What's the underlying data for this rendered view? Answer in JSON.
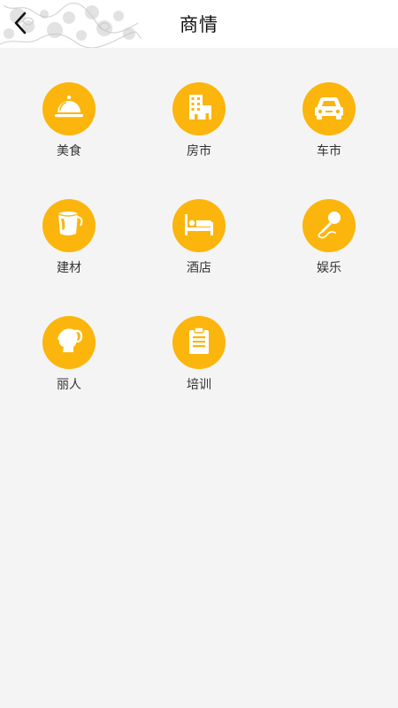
{
  "header": {
    "title": "商情",
    "back_icon": "chevron-left-icon",
    "decoration": "floral-pattern"
  },
  "theme": {
    "accent": "#fbb50c",
    "background": "#f4f4f4",
    "header_bg": "#ffffff",
    "label_color": "#333333"
  },
  "categories": [
    {
      "label": "美食",
      "icon": "food-cloche-icon"
    },
    {
      "label": "房市",
      "icon": "building-icon"
    },
    {
      "label": "车市",
      "icon": "car-icon"
    },
    {
      "label": "建材",
      "icon": "paint-bucket-icon"
    },
    {
      "label": "酒店",
      "icon": "bed-icon"
    },
    {
      "label": "娱乐",
      "icon": "microphone-icon"
    },
    {
      "label": "丽人",
      "icon": "woman-profile-icon"
    },
    {
      "label": "培训",
      "icon": "clipboard-icon"
    }
  ]
}
